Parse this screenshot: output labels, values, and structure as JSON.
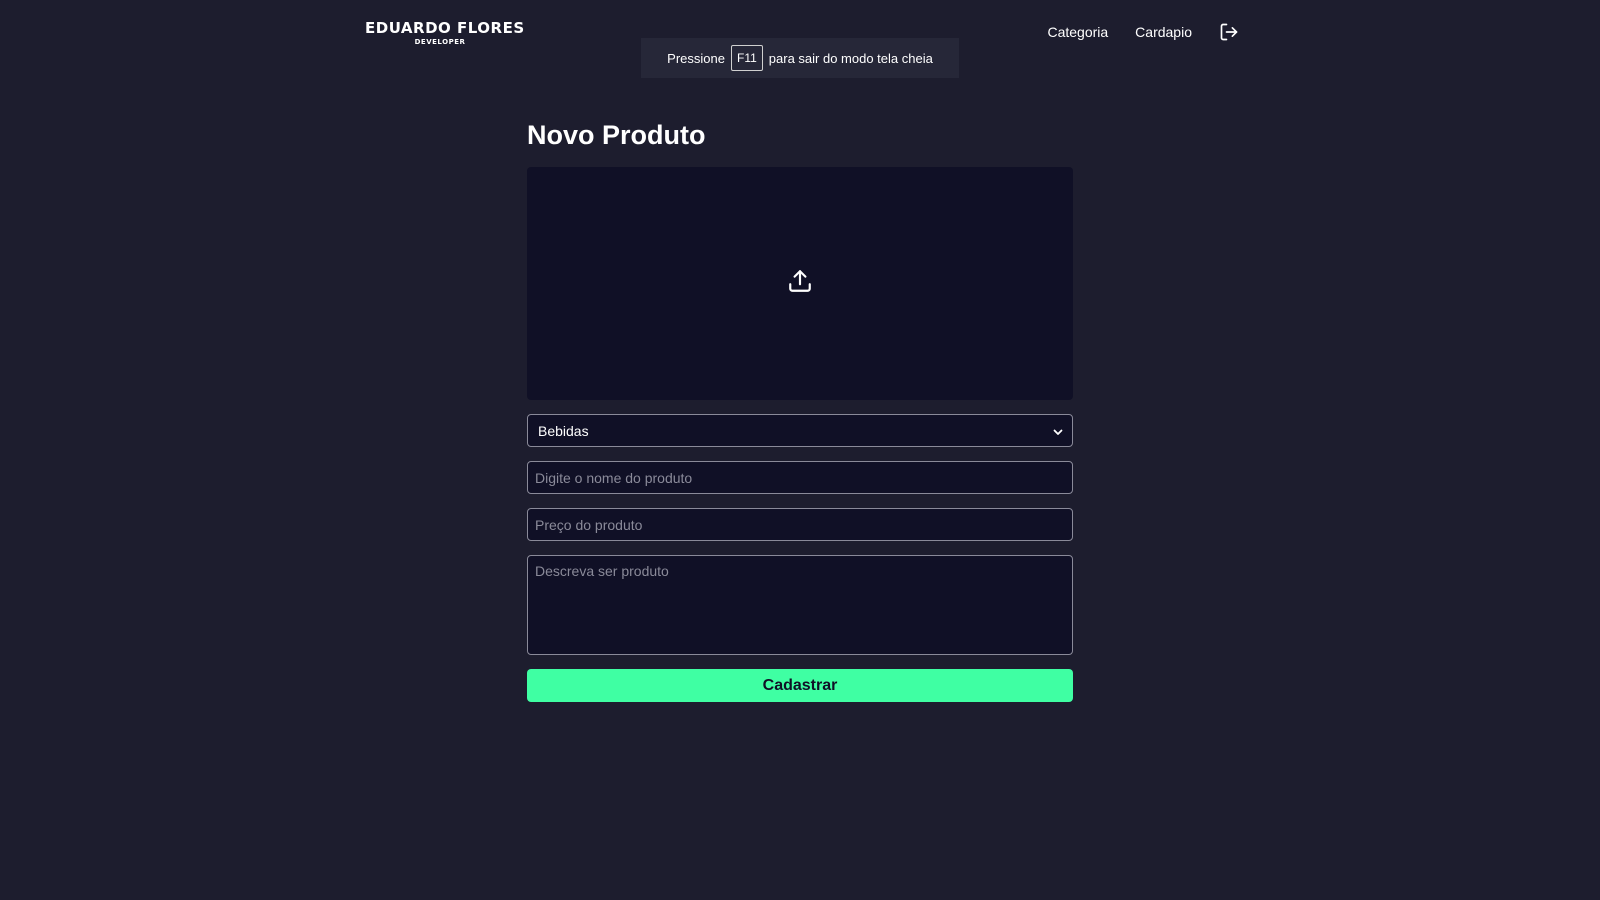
{
  "header": {
    "logo_main": "EDUARDO FLORES",
    "logo_sub": "DEVELOPER",
    "nav": [
      {
        "label": "Categoria"
      },
      {
        "label": "Cardapio"
      }
    ],
    "logout_icon": "logout-icon"
  },
  "fullscreen_notice": {
    "before": "Pressione",
    "key": "F11",
    "after": "para sair do modo tela cheia"
  },
  "form": {
    "title": "Novo Produto",
    "upload_icon": "upload-icon",
    "category_selected": "Bebidas",
    "name_placeholder": "Digite o nome do produto",
    "price_placeholder": "Preço do produto",
    "description_placeholder": "Descreva ser produto",
    "submit_label": "Cadastrar"
  },
  "colors": {
    "background": "#1d1d2e",
    "field_background": "#101026",
    "accent": "#3fffa3"
  }
}
